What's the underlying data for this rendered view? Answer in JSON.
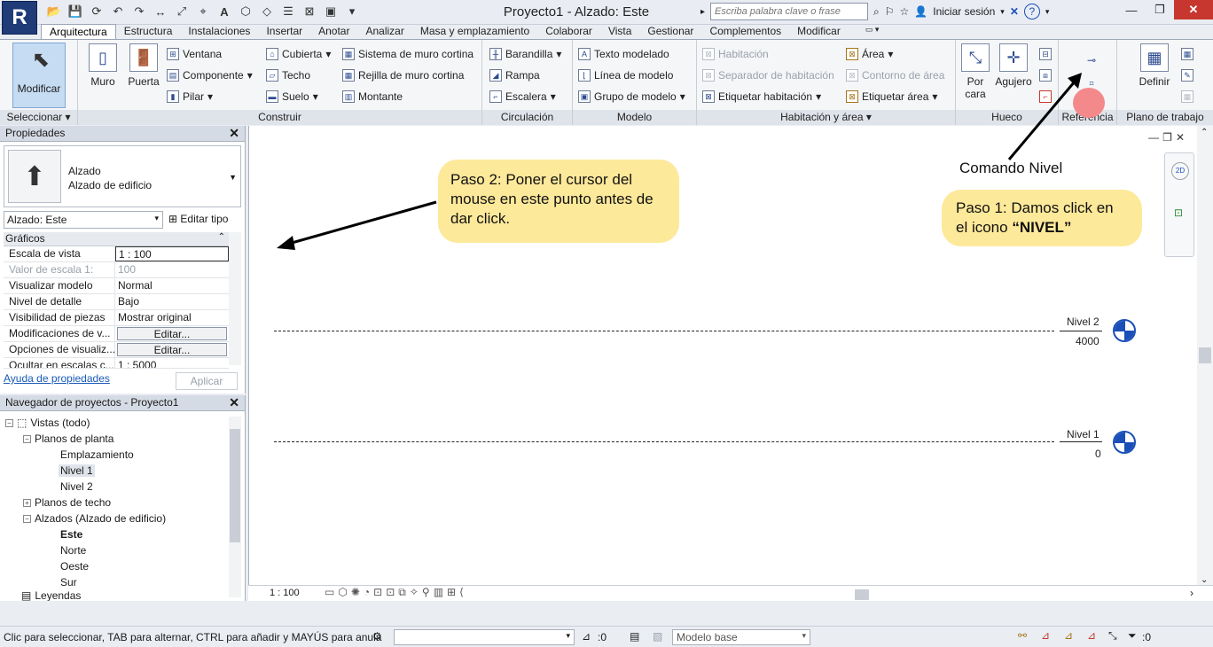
{
  "titlebar": {
    "app_letter": "R",
    "title": "Proyecto1 - Alzado: Este",
    "search_placeholder": "Escriba palabra clave o frase",
    "signin": "Iniciar sesión"
  },
  "ribbon": {
    "tabs": [
      "Arquitectura",
      "Estructura",
      "Instalaciones",
      "Insertar",
      "Anotar",
      "Analizar",
      "Masa y emplazamiento",
      "Colaborar",
      "Vista",
      "Gestionar",
      "Complementos",
      "Modificar"
    ],
    "groups": {
      "seleccionar": "Seleccionar",
      "construir": "Construir",
      "circulacion": "Circulación",
      "modelo": "Modelo",
      "habitacion": "Habitación y área",
      "hueco": "Hueco",
      "referencia": "Referencia",
      "plano": "Plano de trabajo"
    },
    "modificar": "Modificar",
    "muro": "Muro",
    "puerta": "Puerta",
    "ventana": "Ventana",
    "componente": "Componente",
    "pilar": "Pilar",
    "cubierta": "Cubierta",
    "techo": "Techo",
    "suelo": "Suelo",
    "sistema_muro": "Sistema de muro cortina",
    "rejilla_muro": "Rejilla de muro cortina",
    "montante": "Montante",
    "barandilla": "Barandilla",
    "rampa": "Rampa",
    "escalera": "Escalera",
    "texto_modelado": "Texto modelado",
    "linea_modelo": "Línea de modelo",
    "grupo_modelo": "Grupo de modelo",
    "habitacion": "Habitación",
    "separador": "Separador  de habitación",
    "etiquetar_hab": "Etiquetar  habitación",
    "area": "Área",
    "contorno_area": "Contorno  de área",
    "etiquetar_area": "Etiquetar  área",
    "por_cara_1": "Por",
    "por_cara_2": "cara",
    "agujero": "Agujero",
    "definir": "Definir"
  },
  "properties": {
    "header": "Propiedades",
    "type_line1": "Alzado",
    "type_line2": "Alzado de edificio",
    "instance": "Alzado: Este",
    "edit_type": "Editar tipo",
    "category": "Gráficos",
    "rows": [
      {
        "name": "Escala de vista",
        "value": "1 : 100"
      },
      {
        "name": "Valor de escala    1:",
        "value": "100"
      },
      {
        "name": "Visualizar modelo",
        "value": "Normal"
      },
      {
        "name": "Nivel de detalle",
        "value": "Bajo"
      },
      {
        "name": "Visibilidad de piezas",
        "value": "Mostrar original"
      },
      {
        "name": "Modificaciones de v...",
        "value": "Editar..."
      },
      {
        "name": "Opciones de visualiz...",
        "value": "Editar..."
      },
      {
        "name": "Ocultar en escalas c...",
        "value": "1 : 5000"
      }
    ],
    "help": "Ayuda de propiedades",
    "apply": "Aplicar"
  },
  "browser": {
    "header": "Navegador de proyectos - Proyecto1",
    "items": [
      {
        "label": "Vistas (todo)"
      },
      {
        "label": "Planos de planta"
      },
      {
        "label": "Emplazamiento"
      },
      {
        "label": "Nivel 1"
      },
      {
        "label": "Nivel 2"
      },
      {
        "label": "Planos de techo"
      },
      {
        "label": "Alzados (Alzado de edificio)"
      },
      {
        "label": "Este"
      },
      {
        "label": "Norte"
      },
      {
        "label": "Oeste"
      },
      {
        "label": "Sur"
      },
      {
        "label": "Leyendas"
      }
    ]
  },
  "canvas": {
    "levels": [
      {
        "name": "Nivel 2",
        "elevation": "4000"
      },
      {
        "name": "Nivel 1",
        "elevation": "0"
      }
    ],
    "view_scale": "1 : 100"
  },
  "annotations": {
    "paso2": "Paso 2: Poner el cursor del mouse en este punto antes de dar click.",
    "paso1_prefix": "Paso 1: Damos click en el icono ",
    "paso1_bold": "“NIVEL”",
    "comando": "Comando Nivel"
  },
  "statusbar": {
    "text": "Clic para seleccionar, TAB para alternar, CTRL para añadir y MAYÚS para anula",
    "count": ":0",
    "model": "Modelo base",
    "filter": ":0"
  },
  "colors": {
    "callout": "#fde99a",
    "level_blue": "#1a4fb8",
    "highlight": "#f4898c"
  }
}
